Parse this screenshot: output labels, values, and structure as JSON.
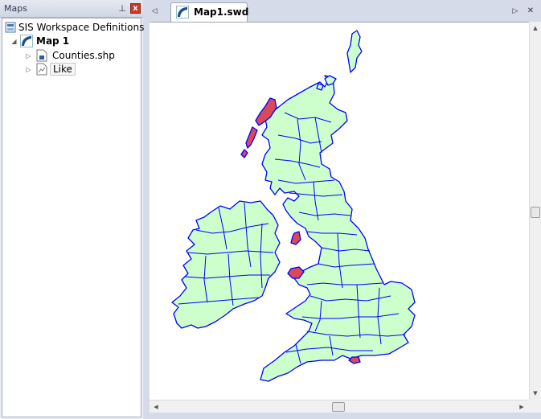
{
  "panel": {
    "title": "Maps",
    "pin_glyph": "⊥",
    "close_glyph": "x"
  },
  "tree": {
    "root_label": "SIS Workspace Definitions",
    "map_label": "Map 1",
    "layers": [
      {
        "label": "Counties.shp",
        "icon": "shapefile-icon"
      },
      {
        "label": "Like",
        "icon": "document-layer-icon"
      }
    ]
  },
  "tabs": [
    {
      "label": "Map1.swd",
      "active": true,
      "icon": "map-document-icon"
    }
  ],
  "colors": {
    "land_fill": "#ccffcc",
    "boundary": "#0000ff",
    "highlight_fill": "#d9495a",
    "accent": "#1a4f8c"
  }
}
